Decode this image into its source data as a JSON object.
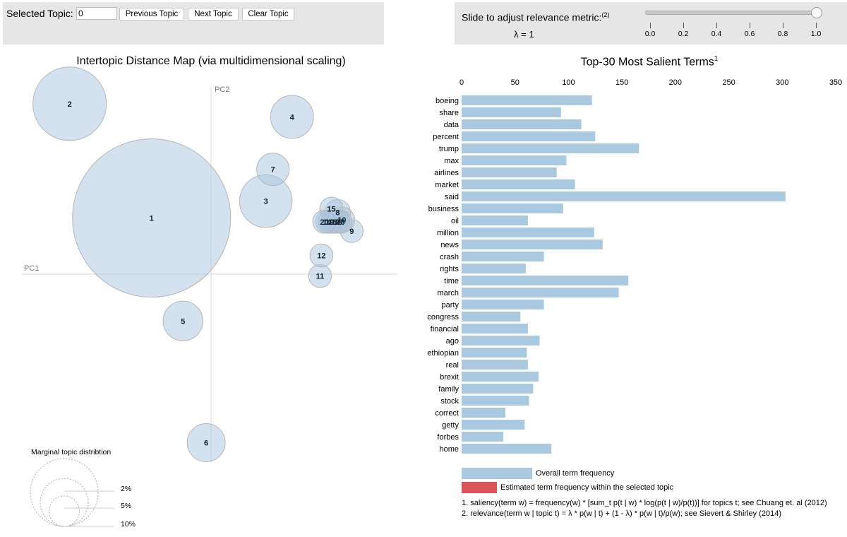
{
  "controls": {
    "selected_topic_label": "Selected Topic:",
    "selected_topic_value": "0",
    "previous_button": "Previous Topic",
    "next_button": "Next Topic",
    "clear_button": "Clear Topic"
  },
  "relevance": {
    "label": "Slide to adjust relevance metric:",
    "label_sup": "(2)",
    "lambda_text": "λ = 1",
    "lambda_value": 1.0,
    "ticks": [
      "0.0",
      "0.2",
      "0.4",
      "0.6",
      "0.8",
      "1.0"
    ]
  },
  "colors": {
    "bubble_fill": "#a9c6e0",
    "bubble_stroke": "#b5b5b5",
    "overall_bar": "#a9c9e1",
    "topic_bar": "#d9535b",
    "axis_line": "#e0e0e0"
  },
  "chart_data": [
    {
      "type": "scatter",
      "title": "Intertopic Distance Map (via multidimensional scaling)",
      "xlabel": "PC1",
      "ylabel": "PC2",
      "note": "bubble size = marginal topic distribution; coordinates in relative map units (origin at PC1/PC2 crossing)",
      "xlim": [
        -1,
        1
      ],
      "ylim": [
        -1,
        1
      ],
      "topics": [
        {
          "id": "1",
          "x": -0.318,
          "y": 0.3,
          "size": 19.0
        },
        {
          "id": "2",
          "x": -0.756,
          "y": 0.91,
          "size": 4.1
        },
        {
          "id": "3",
          "x": 0.293,
          "y": 0.39,
          "size": 2.1
        },
        {
          "id": "4",
          "x": 0.433,
          "y": 0.84,
          "size": 1.4
        },
        {
          "id": "5",
          "x": -0.15,
          "y": -0.25,
          "size": 1.2
        },
        {
          "id": "6",
          "x": -0.026,
          "y": -0.9,
          "size": 1.1
        },
        {
          "id": "7",
          "x": 0.331,
          "y": 0.56,
          "size": 0.8
        },
        {
          "id": "8",
          "x": 0.677,
          "y": 0.33,
          "size": 0.5
        },
        {
          "id": "9",
          "x": 0.752,
          "y": 0.23,
          "size": 0.4
        },
        {
          "id": "10",
          "x": 0.699,
          "y": 0.29,
          "size": 0.5
        },
        {
          "id": "11",
          "x": 0.583,
          "y": -0.01,
          "size": 0.4
        },
        {
          "id": "12",
          "x": 0.59,
          "y": 0.1,
          "size": 0.4
        },
        {
          "id": "13",
          "x": 0.692,
          "y": 0.28,
          "size": 0.4
        },
        {
          "id": "14",
          "x": 0.62,
          "y": 0.28,
          "size": 0.4
        },
        {
          "id": "15",
          "x": 0.643,
          "y": 0.35,
          "size": 0.4
        },
        {
          "id": "16",
          "x": 0.65,
          "y": 0.28,
          "size": 0.4
        },
        {
          "id": "17",
          "x": 0.665,
          "y": 0.28,
          "size": 0.4
        },
        {
          "id": "18",
          "x": 0.68,
          "y": 0.28,
          "size": 0.4
        },
        {
          "id": "19",
          "x": 0.635,
          "y": 0.28,
          "size": 0.4
        },
        {
          "id": "20",
          "x": 0.605,
          "y": 0.28,
          "size": 0.4
        }
      ],
      "legend": {
        "title": "Marginal topic distribtion",
        "entries": [
          "2%",
          "5%",
          "10%"
        ]
      }
    },
    {
      "type": "bar",
      "orientation": "horizontal",
      "title": "Top-30 Most Salient Terms",
      "title_sup": "1",
      "xlim": [
        0,
        350
      ],
      "xticks": [
        "0",
        "50",
        "100",
        "150",
        "200",
        "250",
        "300",
        "350"
      ],
      "categories": [
        "boeing",
        "share",
        "data",
        "percent",
        "trump",
        "max",
        "airlines",
        "market",
        "said",
        "business",
        "oil",
        "million",
        "news",
        "crash",
        "rights",
        "time",
        "march",
        "party",
        "congress",
        "financial",
        "ago",
        "ethiopian",
        "real",
        "brexit",
        "family",
        "stock",
        "correct",
        "getty",
        "forbes",
        "home"
      ],
      "series": [
        {
          "name": "Overall term frequency",
          "values": [
            122,
            93,
            112,
            125,
            166,
            98,
            89,
            106,
            303,
            95,
            62,
            124,
            132,
            77,
            60,
            156,
            147,
            77,
            55,
            62,
            73,
            61,
            62,
            72,
            67,
            63,
            41,
            59,
            39,
            84
          ]
        }
      ],
      "legend": [
        {
          "label": "Overall term frequency",
          "color": "#a9c9e1"
        },
        {
          "label": "Estimated term frequency within the selected topic",
          "color": "#d9535b"
        }
      ]
    }
  ],
  "footnotes": [
    "1. saliency(term w) = frequency(w) * [sum_t p(t | w) * log(p(t | w)/p(t))] for topics t; see Chuang et. al (2012)",
    "2. relevance(term w | topic t) = λ * p(w | t) + (1 - λ) * p(w | t)/p(w); see Sievert & Shirley (2014)"
  ]
}
